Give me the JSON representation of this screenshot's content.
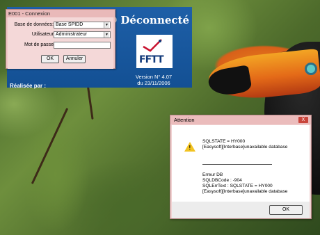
{
  "splash": {
    "title": "SPID Déconnecté",
    "logo_text": "FFTT",
    "version_line1": "Version N° 4.07",
    "version_line2": "du 23/11/2006",
    "realise_par": "Réalisée par :"
  },
  "connexion": {
    "title": "E001 - Connexion",
    "base_label": "Base de données:",
    "base_value": "Base SPIDD",
    "user_label": "Utilisateur",
    "user_value": "Administrateur",
    "password_label": "Mot de passe",
    "password_value": "",
    "ok_label": "OK",
    "cancel_label": "Annuler"
  },
  "attention": {
    "title": "Attention",
    "close_label": "X",
    "lines_top": [
      "SQLSTATE = HY000",
      "[Easysoft][Interbase]unavailable database"
    ],
    "lines_bottom": [
      "Erreur DB",
      "SQLDBCode : -904",
      "SQLErrText : SQLSTATE = HY000",
      "[Easysoft][Interbase]unavailable database"
    ],
    "ok_label": "OK"
  },
  "icons": {
    "warning": "warning-icon",
    "dropdown": "chevron-down-icon",
    "close": "close-icon"
  }
}
